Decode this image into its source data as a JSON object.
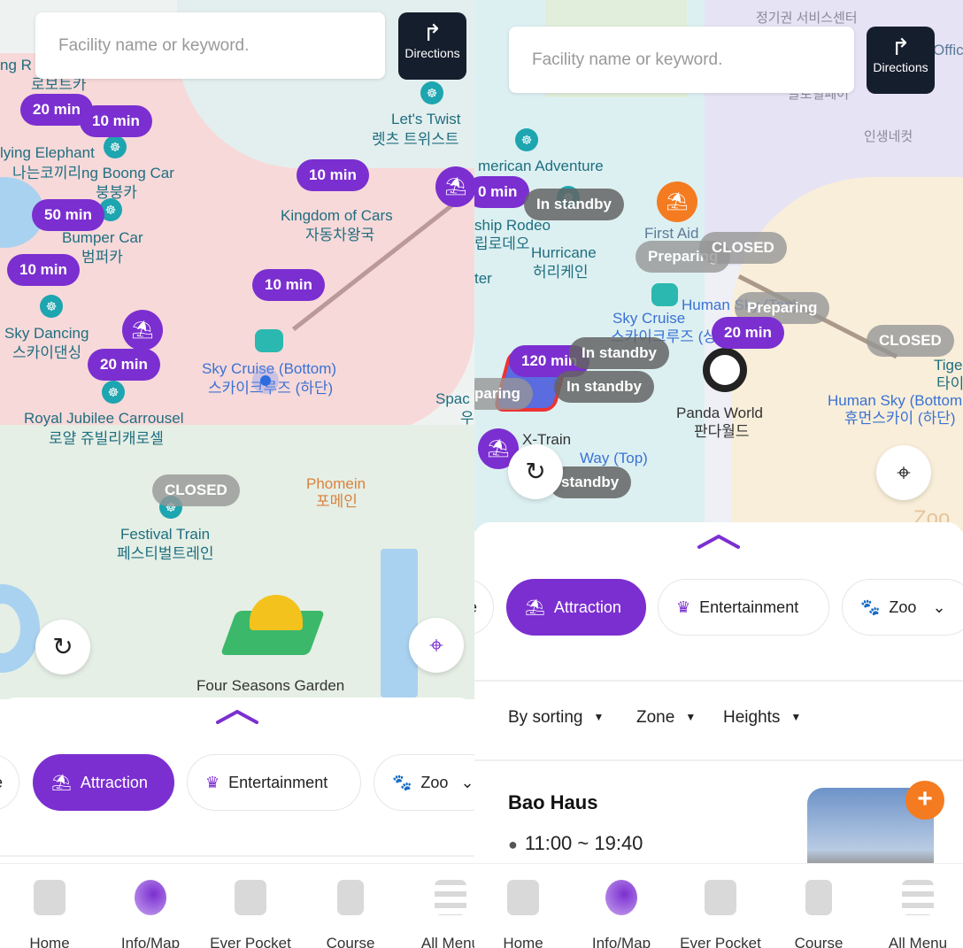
{
  "colors": {
    "accent": "#7b2fd0",
    "directions_bg": "#151e2d",
    "closed_badge": "#8c8c8c",
    "orange_pin": "#f47b20",
    "teal_pin": "#1da5b0"
  },
  "left": {
    "search": {
      "placeholder": "Facility name or keyword.",
      "directions": "Directions",
      "directions_icon": "turn-right-arrow-icon"
    },
    "labels": [
      "ng R",
      "로보트카",
      "lying Elephant",
      "나는코끼리",
      "ng Boong Car",
      "붕붕카",
      "Bumper Car",
      "범퍼카",
      "Sky Dancing",
      "스카이댄싱",
      "Royal Jubilee Carrousel",
      "로얄 쥬빌리캐로셀",
      "Kingdom of Cars",
      "자동차왕국",
      "Let's Twist",
      "렛츠 트위스트",
      "Sky Cruise (Bottom)",
      "스카이크루즈 (하단)",
      "Festival Train",
      "페스티벌트레인",
      "Phomein",
      "포메인",
      "Four Seasons Garden",
      "Spac",
      "우"
    ],
    "badges": [
      "20 min",
      "10 min",
      "10 min",
      "50 min",
      "10 min",
      "10 min",
      "20 min",
      "CLOSED"
    ],
    "chips": [
      {
        "label": "e"
      },
      {
        "label": "Attraction",
        "icon": "carousel-icon",
        "active": true
      },
      {
        "label": "Entertainment",
        "icon": "entertainment-icon"
      },
      {
        "label": "Zoo",
        "icon": "paw-icon"
      }
    ],
    "nav": [
      {
        "label": "Home"
      },
      {
        "label": "Info/Map",
        "active": true
      },
      {
        "label": "Ever Pocket"
      },
      {
        "label": "Course"
      },
      {
        "label": "All Menu"
      }
    ]
  },
  "right": {
    "search": {
      "placeholder": "Facility name or keyword.",
      "directions": "Directions"
    },
    "labels": [
      "정기권 서비스센터",
      "Offic",
      "글로벌페어",
      "인생네컷",
      "merican Adventure",
      "ship Rodeo",
      "립로데오",
      "Hurricane",
      "허리케인",
      "ter",
      "First Aid",
      "Sky Cruise",
      "스카이크루즈 (상",
      "Human Sky (Top)",
      "Panda World",
      "판다월드",
      "Human Sky (Bottom",
      "휴먼스카이 (하단)",
      "Tiger",
      "타이",
      "X-Train",
      "Way (Top)",
      "Zoo"
    ],
    "badges": [
      "0 min",
      "In standby",
      "Preparing",
      "CLOSED",
      "Preparing",
      "20 min",
      "CLOSED",
      "120 min",
      "In standby",
      "In standby",
      "paring",
      "standby"
    ],
    "chips": [
      {
        "label": "e"
      },
      {
        "label": "Attraction",
        "active": true
      },
      {
        "label": "Entertainment"
      },
      {
        "label": "Zoo"
      }
    ],
    "filters": [
      "By sorting",
      "Zone",
      "Heights"
    ],
    "card": {
      "title": "Bao Haus",
      "hours": "11:00 ~ 19:40"
    },
    "nav": [
      {
        "label": "Home"
      },
      {
        "label": "Info/Map",
        "active": true
      },
      {
        "label": "Ever Pocket"
      },
      {
        "label": "Course"
      },
      {
        "label": "All Menu"
      }
    ]
  }
}
